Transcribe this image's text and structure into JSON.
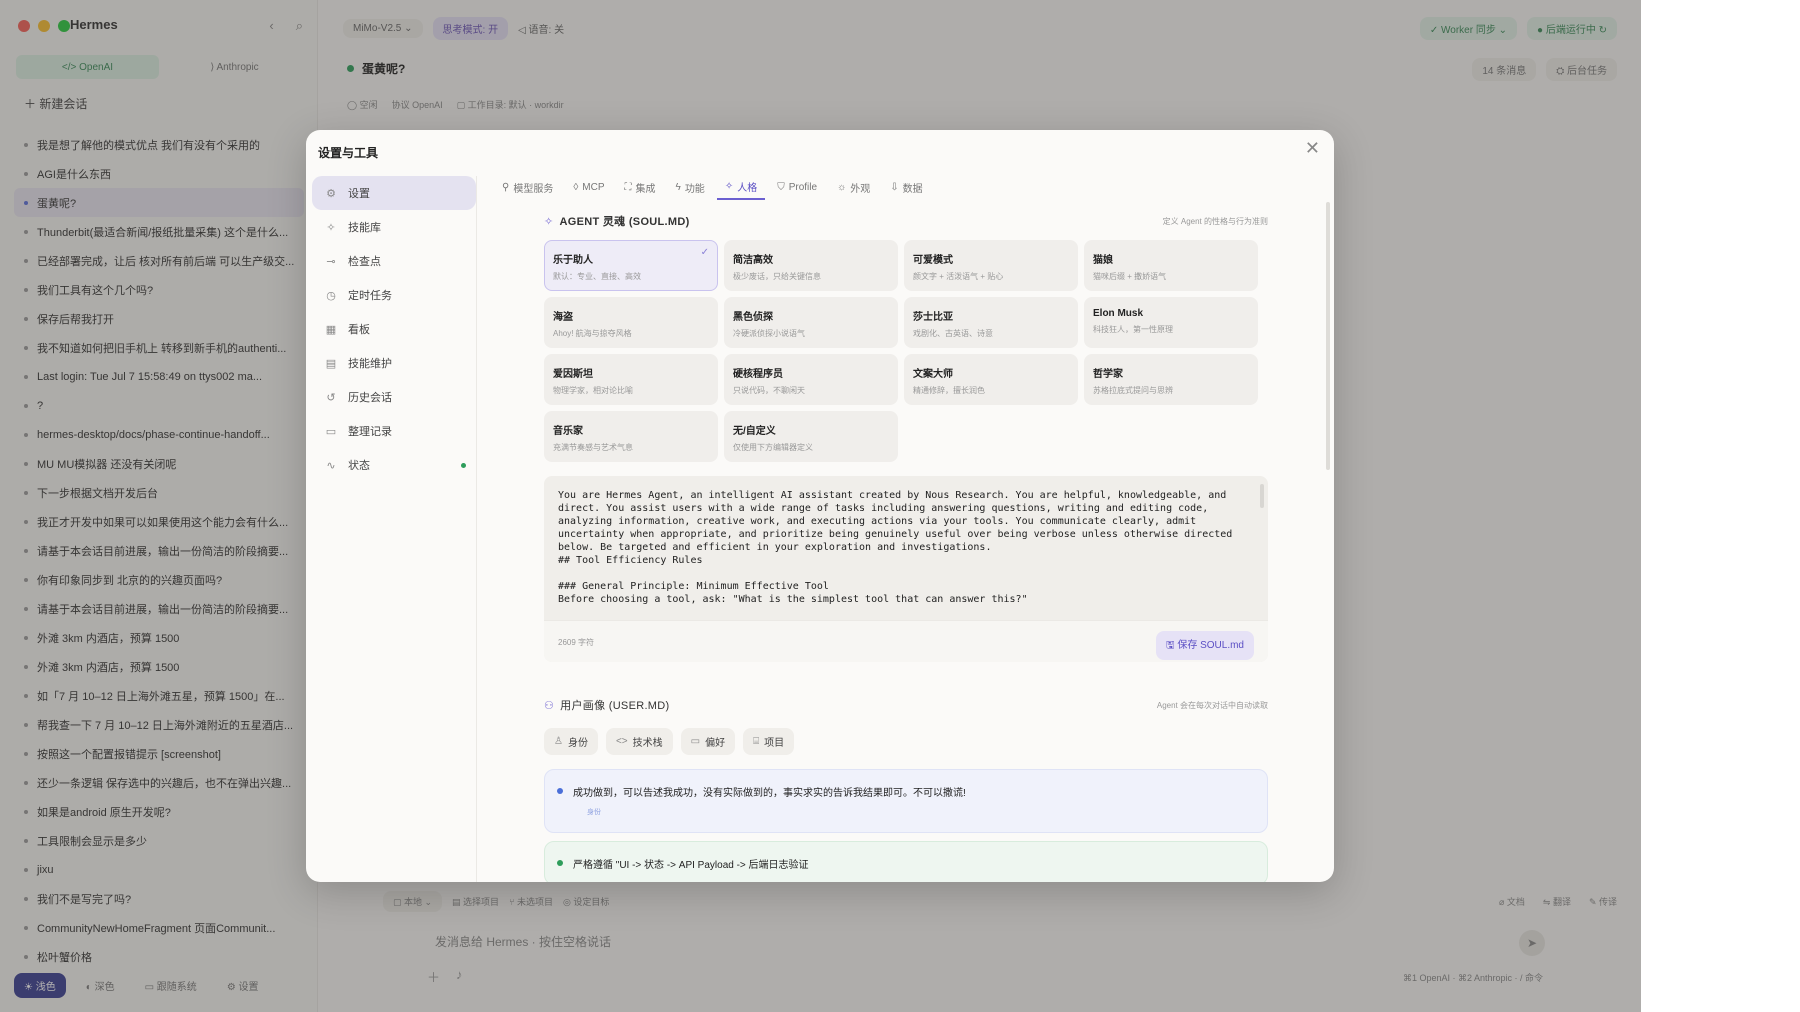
{
  "app": {
    "title": "Hermes"
  },
  "sidebar": {
    "provider_tabs": [
      "</> OpenAI",
      "⟩ Anthropic"
    ],
    "new_chat": "新建会话",
    "chats": [
      "我是想了解他的模式优点 我们有没有个采用的",
      "AGI是什么东西",
      "蛋黄呢?",
      "Thunderbit(最适合新闻/报纸批量采集) 这个是什么...",
      "已经部署完成，让后 核对所有前后端 可以生产级交...",
      "我们工具有这个几个吗?",
      "保存后帮我打开",
      "我不知道如何把旧手机上 转移到新手机的authenti...",
      "Last login: Tue Jul 7 15:58:49 on ttys002 ma...",
      "?",
      "hermes-desktop/docs/phase-continue-handoff...",
      "MU MU模拟器 还没有关闭呢",
      "下一步根据文档开发后台",
      "我正才开发中如果可以如果使用这个能力会有什么...",
      "请基于本会话目前进展，输出一份简洁的阶段摘要...",
      "你有印象同步到 北京的的兴趣页面吗?",
      "请基于本会话目前进展，输出一份简洁的阶段摘要...",
      "外滩 3km 内酒店，预算 1500",
      "外滩 3km 内酒店，预算 1500",
      "如「7 月 10–12 日上海外滩五星，预算 1500」在...",
      "帮我查一下 7 月 10–12 日上海外滩附近的五星酒店...",
      "按照这一个配置报错提示 [screenshot]",
      "还少一条逻辑 保存选中的兴趣后，也不在弹出兴趣...",
      "如果是android 原生开发呢?",
      "工具限制会显示是多少",
      "jixu",
      "我们不是写完了吗?",
      "CommunityNewHomeFragment 页面Communit...",
      "松叶蟹价格"
    ],
    "active_chat_index": 2,
    "bottom": [
      "☀ 浅色",
      "◐ 深色",
      "▭ 跟随系统",
      "⚙ 设置"
    ]
  },
  "main": {
    "model": "MiMo-V2.5 ⌄",
    "think_mode": "思考模式: 开",
    "voice": "◁ 语音: 关",
    "worker": "✓ Worker 同步 ⌄",
    "backend": "● 后端运行中 ↻",
    "chat_title": "蛋黄呢?",
    "msg_count": "14 条消息",
    "bg_tasks": "⛭ 后台任务",
    "meta": [
      "◯ 空闲",
      "协议 OpenAI",
      "▢ 工作目录: 默认 · workdir"
    ],
    "bottom_left": [
      "▢ 本地 ⌄",
      "▤ 选择项目",
      "⑂ 未选项目",
      "◎ 设定目标"
    ],
    "bottom_right": [
      "⌀ 文档",
      "⇋ 翻译",
      "✎ 传译"
    ],
    "composer_placeholder": "发消息给 Hermes · 按住空格说话",
    "shortcut": "⌘1 OpenAI · ⌘2 Anthropic · / 命令"
  },
  "modal": {
    "title": "设置与工具",
    "close": "✕",
    "nav": [
      {
        "icon": "⚙",
        "label": "设置"
      },
      {
        "icon": "✧",
        "label": "技能库"
      },
      {
        "icon": "⊸",
        "label": "检查点"
      },
      {
        "icon": "◷",
        "label": "定时任务"
      },
      {
        "icon": "▦",
        "label": "看板"
      },
      {
        "icon": "▤",
        "label": "技能维护"
      },
      {
        "icon": "↺",
        "label": "历史会话"
      },
      {
        "icon": "▭",
        "label": "整理记录"
      },
      {
        "icon": "∿",
        "label": "状态"
      }
    ],
    "tabs": [
      {
        "icon": "⚲",
        "label": "模型服务"
      },
      {
        "icon": "◊",
        "label": "MCP"
      },
      {
        "icon": "⛶",
        "label": "集成"
      },
      {
        "icon": "ϟ",
        "label": "功能"
      },
      {
        "icon": "✧",
        "label": "人格"
      },
      {
        "icon": "⛉",
        "label": "Profile"
      },
      {
        "icon": "☼",
        "label": "外观"
      },
      {
        "icon": "⇩",
        "label": "数据"
      }
    ],
    "active_tab_index": 4,
    "soul": {
      "title": "AGENT 灵魂 (SOUL.MD)",
      "note": "定义 Agent 的性格与行为准则",
      "personas": [
        {
          "name": "乐于助人",
          "desc": "默认：专业、直接、高效",
          "active": true
        },
        {
          "name": "简洁高效",
          "desc": "极少废话，只给关键信息"
        },
        {
          "name": "可爱模式",
          "desc": "颜文字 + 活泼语气 + 贴心"
        },
        {
          "name": "猫娘",
          "desc": "猫咪后缀 + 撒娇语气"
        },
        {
          "name": "海盗",
          "desc": "Ahoy! 航海与掠夺风格"
        },
        {
          "name": "黑色侦探",
          "desc": "冷硬派侦探小说语气"
        },
        {
          "name": "莎士比亚",
          "desc": "戏剧化、古英语、诗意"
        },
        {
          "name": "Elon Musk",
          "desc": "科技狂人，第一性原理"
        },
        {
          "name": "爱因斯坦",
          "desc": "物理学家，相对论比喻"
        },
        {
          "name": "硬核程序员",
          "desc": "只说代码，不聊闲天"
        },
        {
          "name": "文案大师",
          "desc": "精通修辞，擅长润色"
        },
        {
          "name": "哲学家",
          "desc": "苏格拉底式提问与思辨"
        },
        {
          "name": "音乐家",
          "desc": "充满节奏感与艺术气息"
        },
        {
          "name": "无/自定义",
          "desc": "仅使用下方编辑器定义"
        }
      ],
      "text": "You are Hermes Agent, an intelligent AI assistant created by Nous Research. You are helpful, knowledgeable, and direct. You assist users with a wide range of tasks including answering questions, writing and editing code, analyzing information, creative work, and executing actions via your tools. You communicate clearly, admit uncertainty when appropriate, and prioritize being genuinely useful over being verbose unless otherwise directed below. Be targeted and efficient in your exploration and investigations.\n## Tool Efficiency Rules\n\n### General Principle: Minimum Effective Tool\nBefore choosing a tool, ask: \"What is the simplest tool that can answer this?\"",
      "char_count": "2609 字符",
      "save_label": "🖫 保存 SOUL.md"
    },
    "user": {
      "title": "用户画像 (USER.MD)",
      "note": "Agent 会在每次对话中自动读取",
      "chips": [
        {
          "icon": "♙",
          "label": "身份"
        },
        {
          "icon": "<>",
          "label": "技术栈"
        },
        {
          "icon": "▭",
          "label": "偏好"
        },
        {
          "icon": "⌸",
          "label": "项目"
        }
      ],
      "notes": [
        {
          "text": "成功做到，可以告述我成功，没有实际做到的，事实求实的告诉我结果即可。不可以撒谎!",
          "tag": "身份"
        },
        {
          "text": "严格遵循 \"UI -> 状态 -> API Payload -> 后端日志验证"
        }
      ]
    }
  },
  "colors": {
    "accent": "#6b5fd0",
    "green": "#2e9d5b",
    "sidebar_active": "#3b3f91"
  }
}
